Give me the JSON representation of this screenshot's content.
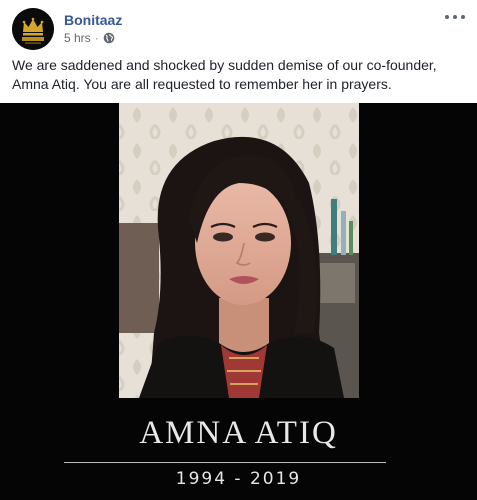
{
  "post": {
    "author": "Bonitaaz",
    "time": "5 hrs",
    "privacy_icon": "globe-icon",
    "more_icon": "more-options-icon",
    "text": "We are saddened and shocked by sudden demise of our co-founder, Amna Atiq. You are all requested to remember her in prayers."
  },
  "image": {
    "name": "AMNA ATIQ",
    "years": "1994 - 2019"
  },
  "colors": {
    "author_link": "#385898",
    "text": "#1d2129",
    "meta": "#616770",
    "photo_background": "#050505",
    "avatar_gold": "#d4a72c"
  }
}
